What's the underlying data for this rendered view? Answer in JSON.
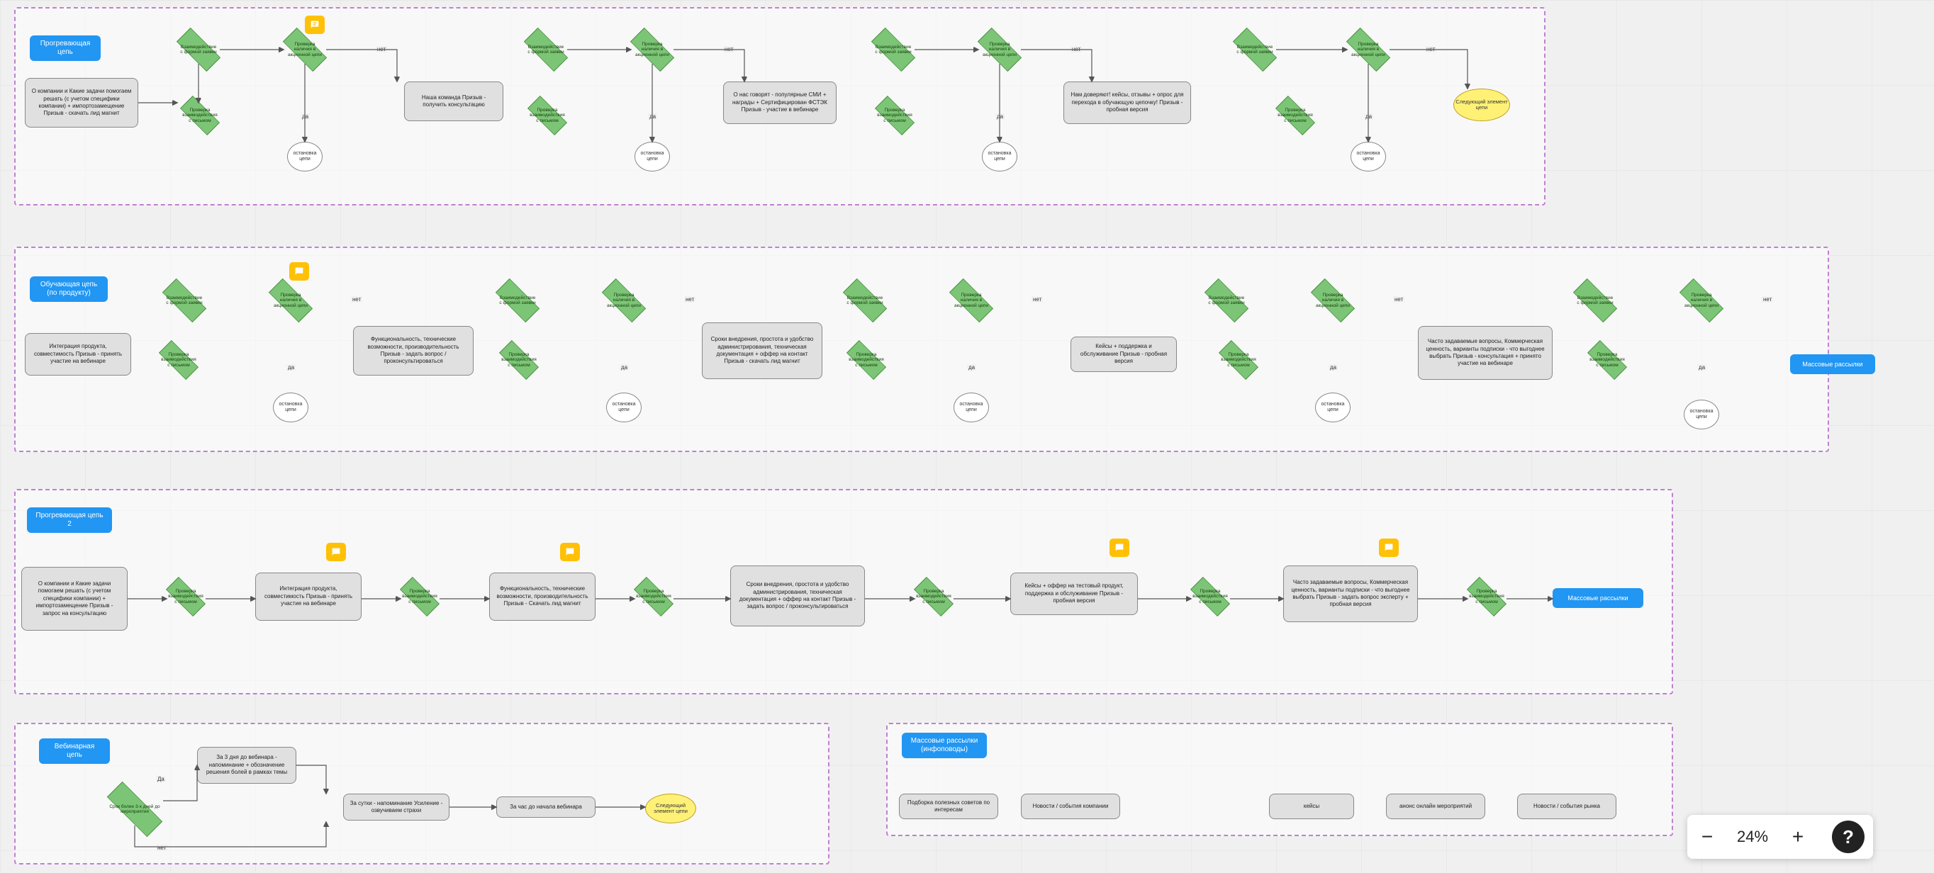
{
  "zoom": {
    "level": "24%",
    "minus": "−",
    "plus": "+",
    "help": "?"
  },
  "labels": {
    "yes": "да",
    "no": "нет",
    "yes_cap": "Да",
    "stop": "остановка цепи",
    "next_elem": "Следующий элемент цепи",
    "mass": "Массовые рассылки",
    "interact_form": "Взаимодействие с формой заявки",
    "check_chain": "Проверка наличия в акционной цепи",
    "check_mail": "Проверка взаимодействия с письмом"
  },
  "f1": {
    "title": "Прогревающая цепь",
    "box1": "О компании и\nКакие задачи помогаем решать (с учетом специфики компании) + импортозамещение\nПризыв - скачать лид магнит",
    "box2": "Наша команда\nПризыв - получить консультацию",
    "box3": "О нас говорят - популярные СМИ + награды + Сертифицирован ФСТЭК\nПризыв - участие в вебинаре",
    "box4": "Нам доверяют!\nкейсы, отзывы + опрос для перехода в обучающую цепочку!\nПризыв - пробная версия"
  },
  "f2": {
    "title": "Обучающая цепь\n(по продукту)",
    "box1": "Интеграция продукта, совместимость\nПризыв - принять участие на вебинаре",
    "box2": "Функциональность, технические возможности, производительность\nПризыв - задать вопрос / проконсультироваться",
    "box3": "Сроки внедрения, простота и удобство администрирования, техническая документация + оффер на контакт\nПризыв - скачать лид магнит",
    "box4": "Кейсы + поддержка и обслуживание\nПризыв - пробная версия",
    "box5": "Часто задаваемые вопросы, Коммерческая ценность, варианты подписки - что выгоднее выбрать\nПризыв - консультация + принято участие на вебинаре"
  },
  "f3": {
    "title": "Прогревающая цепь 2",
    "box1": "О компании и\nКакие задачи помогаем решать (с учетом специфики компании) + импортозамещение\nПризыв - запрос на консультацию",
    "box2": "Интеграция продукта, совместимость\nПризыв - принять участие на вебинаре",
    "box3": "Функциональность, технические возможности, производительность\nПризыв - Скачать лид магнит",
    "box4": "Сроки внедрения, простота и удобство администрирования, техническая документация + оффер на контакт\nПризыв - задать вопрос / проконсультироваться",
    "box5": "Кейсы + оффер на тестовый продукт, поддержка и обслуживание\nПризыв - пробная версия",
    "box6": "Часто задаваемые вопросы, Коммерческая ценность, варианты подписки - что выгоднее выбрать\nПризыв - задать вопрос эксперту + пробная версия"
  },
  "f4": {
    "title": "Вебинарная цепь",
    "d1": "Срок более 3-х дней до мероприятия",
    "box1": "За 3 дня до вебинара - напоминание + обозначение решения болей в рамках темы",
    "box2": "За сутки - напоминание\nУсиление - озвучиваем страхи",
    "box3": "За час до начала вебинара"
  },
  "f5": {
    "title": "Массовые рассылки\n(инфоповоды)",
    "c1": "Подборка полезных советов по интересам",
    "c2": "Новости / события компании",
    "c3": "кейсы",
    "c4": "анонс онлайн мероприятий",
    "c5": "Новости / события рынка"
  }
}
